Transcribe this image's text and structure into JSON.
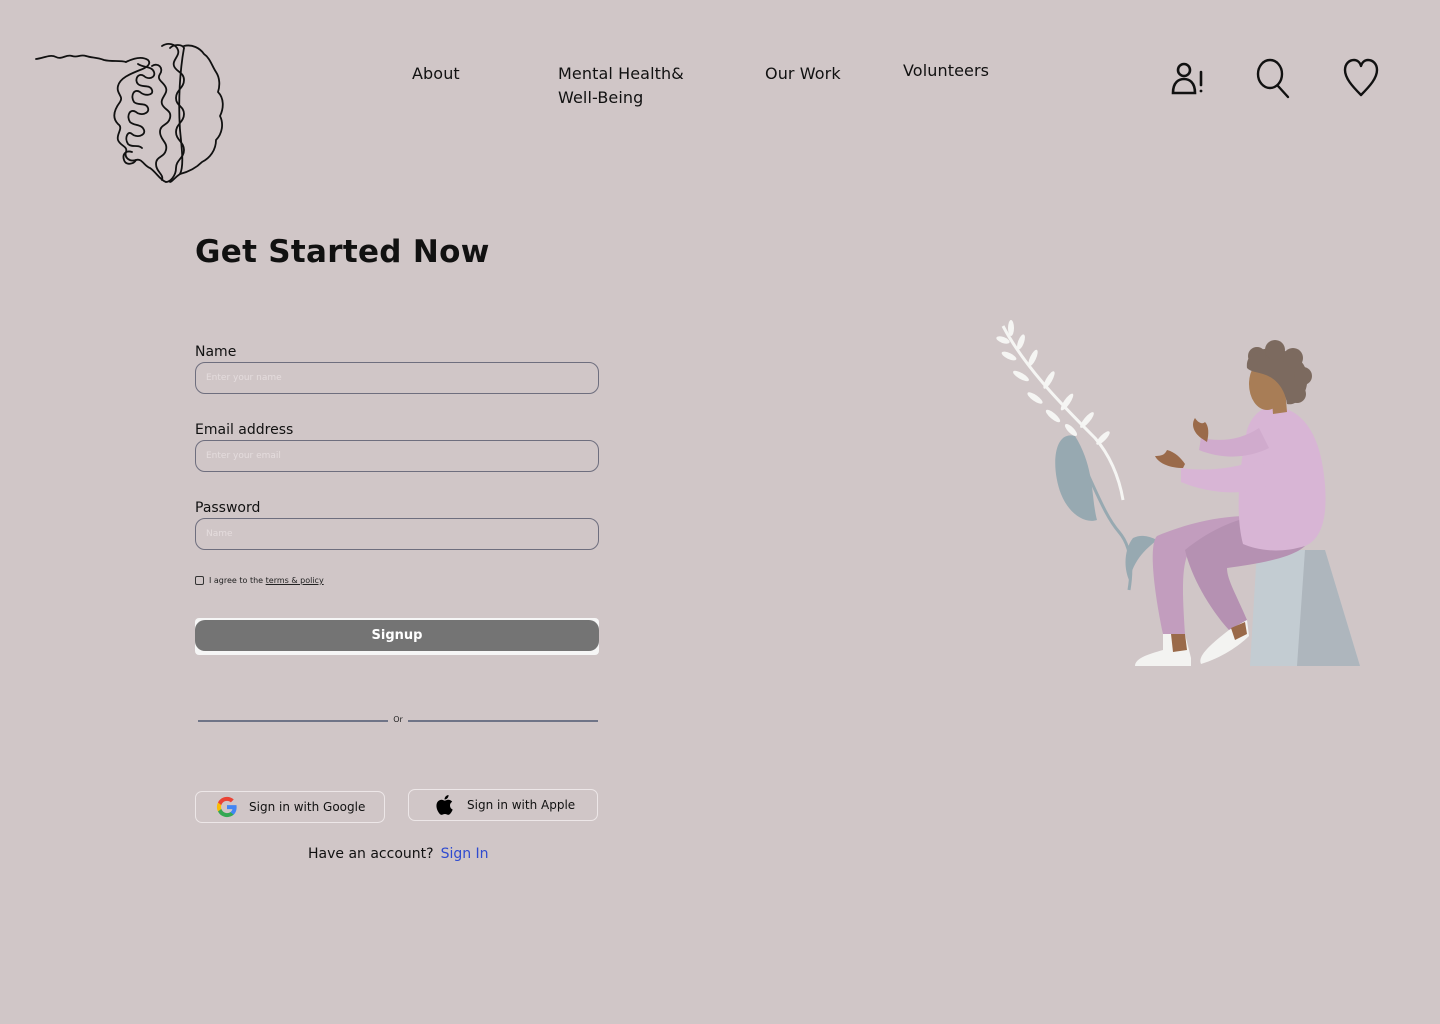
{
  "nav": {
    "about": "About",
    "mental_line1": "Mental Health&",
    "mental_line2": "Well-Being",
    "our_work": "Our Work",
    "volunteers": "Volunteers"
  },
  "header_icons": [
    "user-alert-icon",
    "search-icon",
    "heart-icon"
  ],
  "form": {
    "title": "Get Started Now",
    "name_label": "Name",
    "name_placeholder": "Enter your name",
    "email_label": "Email address",
    "email_placeholder": "Enter your email",
    "password_label": "Password",
    "password_placeholder": "Name",
    "terms_prefix": "I agree to the",
    "terms_link": "terms & policy",
    "signup_label": "Signup",
    "divider_text": "Or",
    "google_label": "Sign in with Google",
    "apple_label": "Sign in with Apple",
    "have_account": "Have an account?",
    "sign_in": "Sign In"
  },
  "colors": {
    "background": "#D0C6C7",
    "signup_button": "#747474",
    "sign_in_link": "#2F4BD0",
    "divider": "#6F7487"
  }
}
